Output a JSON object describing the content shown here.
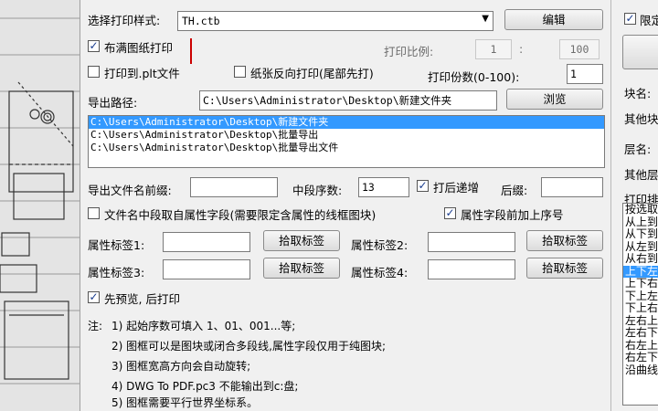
{
  "print_style": {
    "label": "选择打印样式:",
    "value": "TH.ctb",
    "edit_button": "编辑"
  },
  "fill_paper": {
    "label": "布满图纸打印",
    "checked": true
  },
  "scale": {
    "label": "打印比例:",
    "left": "1",
    "sep": ":",
    "right": "100"
  },
  "print_to_plt": {
    "label": "打印到.plt文件",
    "checked": false
  },
  "reverse_print": {
    "label": "纸张反向打印(尾部先打)",
    "checked": false
  },
  "copies": {
    "label": "打印份数(0-100):",
    "value": "1"
  },
  "export_path": {
    "label": "导出路径:",
    "value": "C:\\Users\\Administrator\\Desktop\\新建文件夹",
    "browse_button": "浏览"
  },
  "path_list": [
    "C:\\Users\\Administrator\\Desktop\\新建文件夹",
    "C:\\Users\\Administrator\\Desktop\\批量导出",
    "C:\\Users\\Administrator\\Desktop\\批量导出文件"
  ],
  "filename": {
    "prefix_label": "导出文件名前缀:",
    "prefix_value": "",
    "mid_label": "中段序数:",
    "mid_value": "13",
    "increment_label": "打后递增",
    "increment_checked": true,
    "suffix_label": "后缀:",
    "suffix_value": ""
  },
  "mid_from_attr": {
    "label": "文件名中段取自属性字段(需要限定含属性的线框图块)",
    "checked": false
  },
  "attr_prefix_seq": {
    "label": "属性字段前加上序号",
    "checked": true
  },
  "attr_tags": [
    {
      "label": "属性标签1:",
      "value": "",
      "button": "拾取标签"
    },
    {
      "label": "属性标签2:",
      "value": "",
      "button": "拾取标签"
    },
    {
      "label": "属性标签3:",
      "value": "",
      "button": "拾取标签"
    },
    {
      "label": "属性标签4:",
      "value": "",
      "button": "拾取标签"
    }
  ],
  "preview_first": {
    "label": "先预览, 后打印",
    "checked": true
  },
  "notes": {
    "prefix": "注:",
    "lines": [
      "1) 起始序数可填入 1、01、001...等;",
      "2) 图框可以是图块或闭合多段线,属性字段仅用于纯图块;",
      "3) 图框宽高方向会自动旋转;",
      "4) DWG To PDF.pc3 不能输出到c:盘;",
      "5) 图框需要平行世界坐标系。"
    ]
  },
  "right_panel": {
    "limit_label": "限定",
    "limit_checked": true,
    "block_name": "块名:",
    "other_block": "其他块",
    "layer_name": "层名:",
    "other_layer": "其他层",
    "print_order": "打印排",
    "order_items": [
      "按选取",
      "从上到",
      "从下到",
      "从左到",
      "从右到",
      "上下左",
      "上下右",
      "下上左",
      "下上右",
      "左右上",
      "左右下",
      "右左上",
      "右左下",
      "沿曲线"
    ],
    "selected_index": 5
  },
  "colors": {
    "selection": "#3399ff",
    "marker": "#cc0000"
  }
}
